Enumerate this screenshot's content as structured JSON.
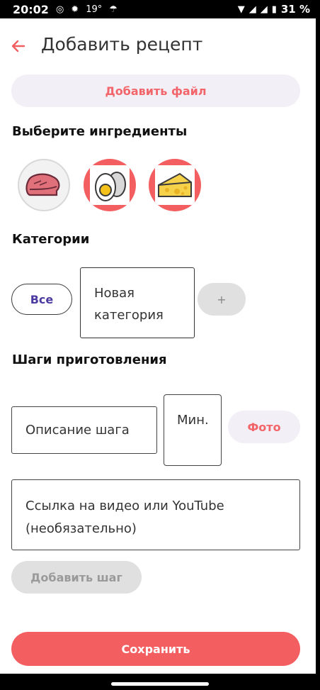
{
  "status_bar": {
    "time": "20:02",
    "temperature": "19°",
    "battery": "31 %"
  },
  "header": {
    "title": "Добавить рецепт"
  },
  "add_file_label": "Добавить файл",
  "ingredients": {
    "title": "Выберите ингредиенты",
    "items": [
      "meat-icon",
      "egg-icon",
      "cheese-icon"
    ]
  },
  "categories": {
    "title": "Категории",
    "all_label": "Все",
    "new_category_placeholder": "Новая категория",
    "add_label": "+"
  },
  "steps": {
    "title": "Шаги приготовления",
    "description_placeholder": "Описание шага",
    "minutes_placeholder": "Мин.",
    "photo_label": "Фото",
    "video_placeholder": "Ссылка на видео или YouTube (необязательно)",
    "add_step_label": "Добавить шаг"
  },
  "save_label": "Сохранить",
  "colors": {
    "accent": "#f35f61",
    "accent_text": "#f2656a",
    "chip_text": "#4d3aa0",
    "pill_bg": "#f2f0f6"
  }
}
